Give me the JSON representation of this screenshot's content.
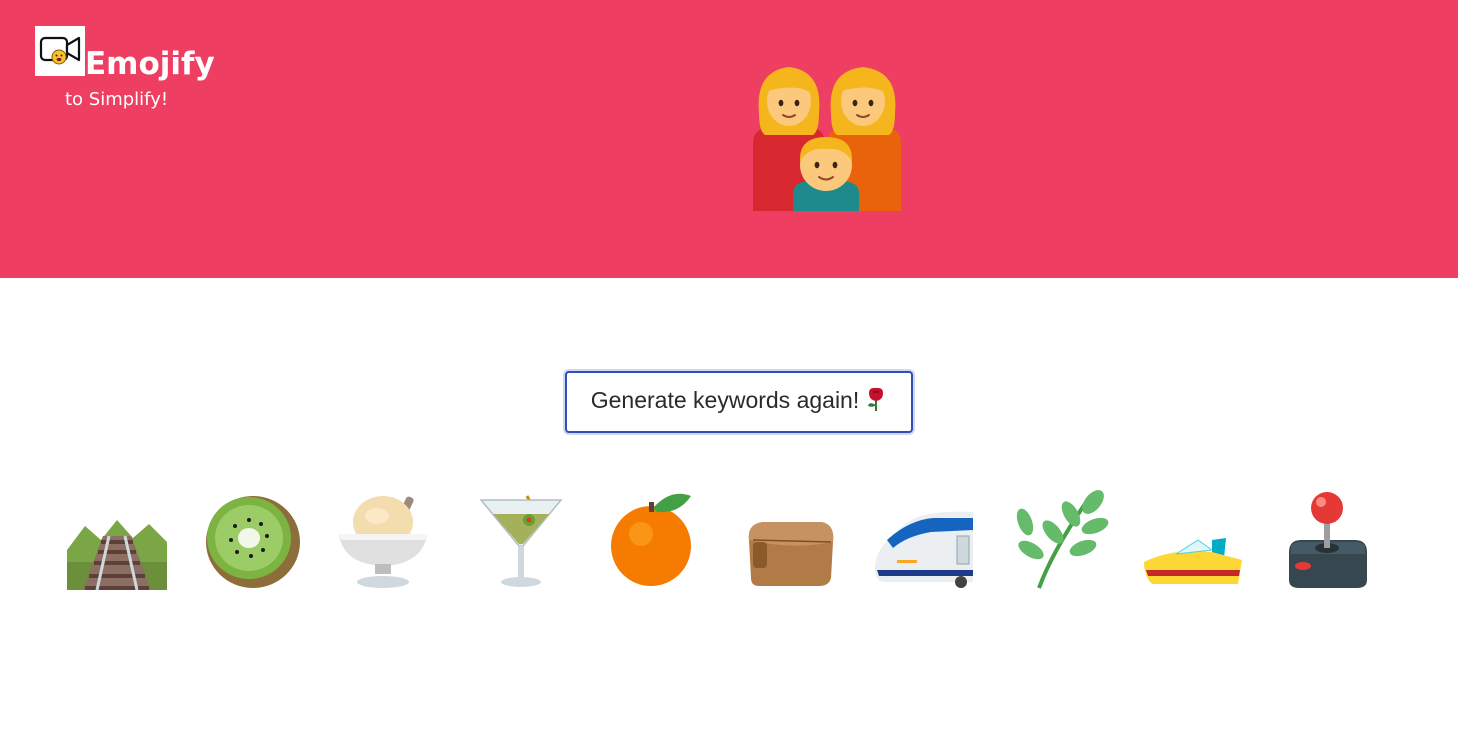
{
  "header": {
    "brand_title": "Emojify",
    "brand_subtitle": "to Simplify!",
    "logo_icon": "video-camera-emoji-face-icon",
    "hero_icon": "family-woman-woman-boy-emoji",
    "background_color": "#ee3e62"
  },
  "main": {
    "generate_button_label": "Generate keywords again!",
    "generate_button_icon": "rose-emoji",
    "emojis": [
      "railway-track-emoji",
      "kiwi-fruit-emoji",
      "ice-cream-emoji",
      "cocktail-glass-emoji",
      "tangerine-emoji",
      "clutch-bag-emoji",
      "high-speed-train-emoji",
      "herb-emoji",
      "speedboat-emoji",
      "joystick-emoji"
    ]
  }
}
